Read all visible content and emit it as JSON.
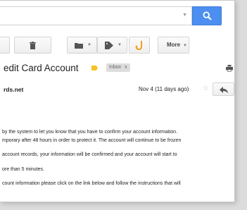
{
  "search": {
    "value": "",
    "placeholder": ""
  },
  "toolbar": {
    "more_label": "More"
  },
  "message": {
    "subject": "edit Card Account",
    "label_chip": "Inbox",
    "label_chip_close": "x",
    "sender": "rds.net",
    "date": "Nov 4 (11 days ago)",
    "body_lines": [
      "by the system to let you know that you have to confirm your account information.",
      "mporary after 48 hours in order to protect it. The account will continue to be frozen",
      "account records, your information will be confirmed and your account will start to",
      "ore than 5 minutes.",
      "count information please click on the link below and follow the instructions that will"
    ]
  },
  "colors": {
    "search_button": "#4d8ff0",
    "label_tag": "#f6c026",
    "undo_icon": "#f0a020"
  },
  "icons": [
    "search-icon",
    "trash-icon",
    "folder-icon",
    "tag-icon",
    "undo-icon",
    "print-icon",
    "star-icon",
    "reply-icon"
  ]
}
